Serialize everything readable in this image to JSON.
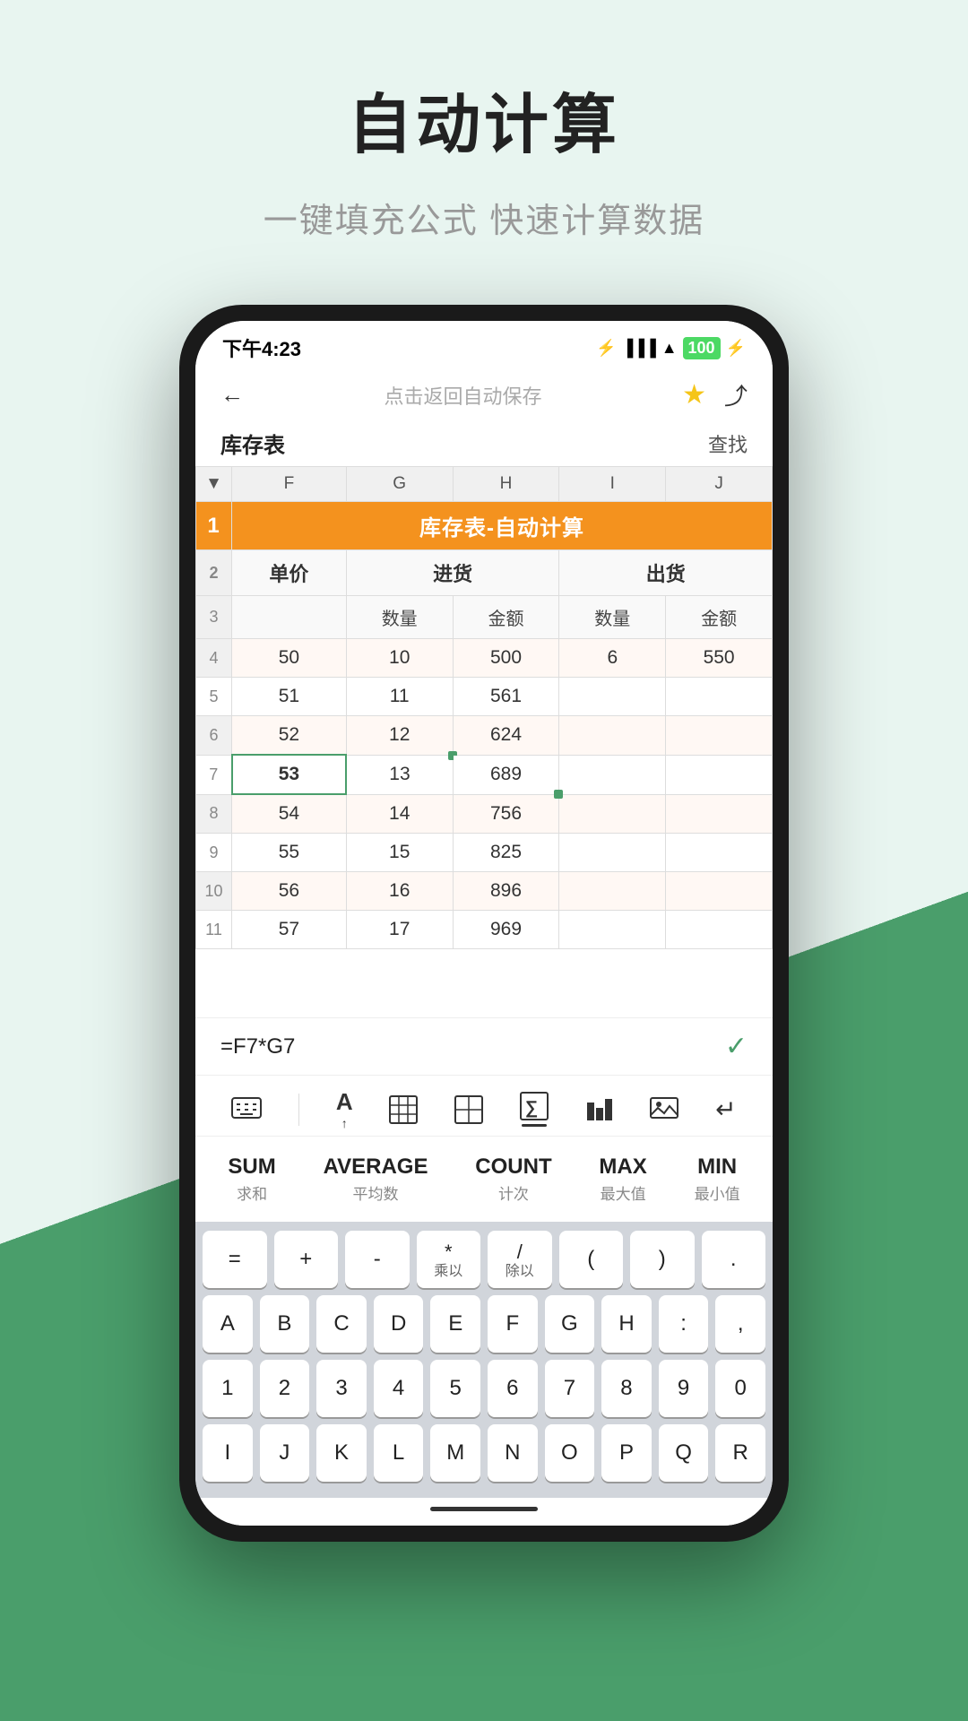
{
  "page": {
    "title": "自动计算",
    "subtitle": "一键填充公式 快速计算数据"
  },
  "statusBar": {
    "time": "下午4:23",
    "battery": "100"
  },
  "nav": {
    "back": "←",
    "title": "点击返回自动保存",
    "find": "查找"
  },
  "sheet": {
    "title": "库存表",
    "spreadsheetTitle": "库存表-自动计算"
  },
  "columns": [
    "F",
    "G",
    "H",
    "I",
    "J"
  ],
  "tableHeaders": {
    "row2": [
      "单价",
      "进货",
      "",
      "出货",
      ""
    ],
    "row3": [
      "",
      "数量",
      "金额",
      "数量",
      "金额"
    ]
  },
  "rows": [
    {
      "num": 4,
      "cells": [
        "50",
        "10",
        "500",
        "6",
        "550"
      ]
    },
    {
      "num": 5,
      "cells": [
        "51",
        "11",
        "561",
        "",
        ""
      ]
    },
    {
      "num": 6,
      "cells": [
        "52",
        "12",
        "624",
        "",
        ""
      ]
    },
    {
      "num": 7,
      "cells": [
        "53",
        "13",
        "689",
        "",
        ""
      ],
      "selected": 0
    },
    {
      "num": 8,
      "cells": [
        "54",
        "14",
        "756",
        "",
        ""
      ]
    },
    {
      "num": 9,
      "cells": [
        "55",
        "15",
        "825",
        "",
        ""
      ]
    },
    {
      "num": 10,
      "cells": [
        "56",
        "16",
        "896",
        "",
        ""
      ]
    },
    {
      "num": 11,
      "cells": [
        "57",
        "17",
        "969",
        "",
        ""
      ]
    }
  ],
  "formulaBar": {
    "formula": "=F7*G7",
    "check": "✓"
  },
  "toolbar": {
    "items": [
      "⊟",
      "A↑",
      "⊞",
      "⊡",
      "⊠",
      "⁞⁞",
      "⊟↓",
      "↵"
    ],
    "activeIndex": 4
  },
  "functions": [
    {
      "name": "SUM",
      "label": "求和"
    },
    {
      "name": "AVERAGE",
      "label": "平均数"
    },
    {
      "name": "COUNT",
      "label": "计次"
    },
    {
      "name": "MAX",
      "label": "最大值"
    },
    {
      "name": "MIN",
      "label": "最小值"
    }
  ],
  "keyboard": {
    "row1": [
      "=",
      "+",
      "-",
      {
        "main": "*",
        "sub": "乘以"
      },
      {
        "main": "/",
        "sub": "除以"
      },
      "(",
      ")",
      "."
    ],
    "row2": [
      "A",
      "B",
      "C",
      "D",
      "E",
      "F",
      "G",
      "H",
      ":",
      ","
    ],
    "row3": [
      "1",
      "2",
      "3",
      "4",
      "5",
      "6",
      "7",
      "8",
      "9",
      "0"
    ],
    "row4": [
      "I",
      "J",
      "K",
      "L",
      "M",
      "N",
      "O",
      "P",
      "Q",
      "R"
    ]
  }
}
